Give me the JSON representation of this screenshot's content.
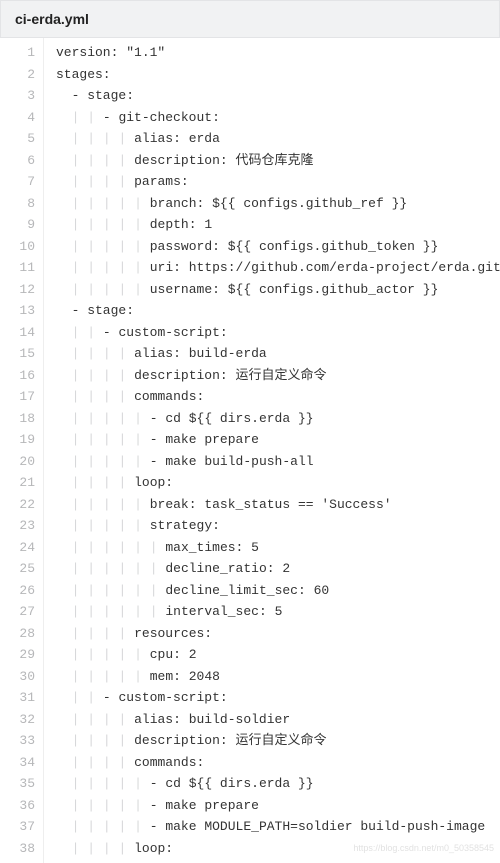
{
  "header": {
    "filename": "ci-erda.yml"
  },
  "guide_char": "|",
  "watermark": "https://blog.csdn.net/m0_50358545",
  "lines": [
    {
      "n": 1,
      "indent": 0,
      "text": "version: \"1.1\""
    },
    {
      "n": 2,
      "indent": 0,
      "text": "stages:"
    },
    {
      "n": 3,
      "indent": 1,
      "text": "- stage:"
    },
    {
      "n": 4,
      "indent": 3,
      "text": "- git-checkout:"
    },
    {
      "n": 5,
      "indent": 5,
      "text": "alias: erda"
    },
    {
      "n": 6,
      "indent": 5,
      "text": "description: 代码仓库克隆"
    },
    {
      "n": 7,
      "indent": 5,
      "text": "params:"
    },
    {
      "n": 8,
      "indent": 6,
      "text": "branch: ${{ configs.github_ref }}"
    },
    {
      "n": 9,
      "indent": 6,
      "text": "depth: 1"
    },
    {
      "n": 10,
      "indent": 6,
      "text": "password: ${{ configs.github_token }}"
    },
    {
      "n": 11,
      "indent": 6,
      "text": "uri: https://github.com/erda-project/erda.git"
    },
    {
      "n": 12,
      "indent": 6,
      "text": "username: ${{ configs.github_actor }}"
    },
    {
      "n": 13,
      "indent": 1,
      "text": "- stage:"
    },
    {
      "n": 14,
      "indent": 3,
      "text": "- custom-script:"
    },
    {
      "n": 15,
      "indent": 5,
      "text": "alias: build-erda"
    },
    {
      "n": 16,
      "indent": 5,
      "text": "description: 运行自定义命令"
    },
    {
      "n": 17,
      "indent": 5,
      "text": "commands:"
    },
    {
      "n": 18,
      "indent": 6,
      "text": "- cd ${{ dirs.erda }}"
    },
    {
      "n": 19,
      "indent": 6,
      "text": "- make prepare"
    },
    {
      "n": 20,
      "indent": 6,
      "text": "- make build-push-all"
    },
    {
      "n": 21,
      "indent": 5,
      "text": "loop:"
    },
    {
      "n": 22,
      "indent": 6,
      "text": "break: task_status == 'Success'"
    },
    {
      "n": 23,
      "indent": 6,
      "text": "strategy:"
    },
    {
      "n": 24,
      "indent": 7,
      "text": "max_times: 5"
    },
    {
      "n": 25,
      "indent": 7,
      "text": "decline_ratio: 2"
    },
    {
      "n": 26,
      "indent": 7,
      "text": "decline_limit_sec: 60"
    },
    {
      "n": 27,
      "indent": 7,
      "text": "interval_sec: 5"
    },
    {
      "n": 28,
      "indent": 5,
      "text": "resources:"
    },
    {
      "n": 29,
      "indent": 6,
      "text": "cpu: 2"
    },
    {
      "n": 30,
      "indent": 6,
      "text": "mem: 2048"
    },
    {
      "n": 31,
      "indent": 3,
      "text": "- custom-script:"
    },
    {
      "n": 32,
      "indent": 5,
      "text": "alias: build-soldier"
    },
    {
      "n": 33,
      "indent": 5,
      "text": "description: 运行自定义命令"
    },
    {
      "n": 34,
      "indent": 5,
      "text": "commands:"
    },
    {
      "n": 35,
      "indent": 6,
      "text": "- cd ${{ dirs.erda }}"
    },
    {
      "n": 36,
      "indent": 6,
      "text": "- make prepare"
    },
    {
      "n": 37,
      "indent": 6,
      "text": "- make MODULE_PATH=soldier build-push-image"
    },
    {
      "n": 38,
      "indent": 5,
      "text": "loop:"
    }
  ]
}
